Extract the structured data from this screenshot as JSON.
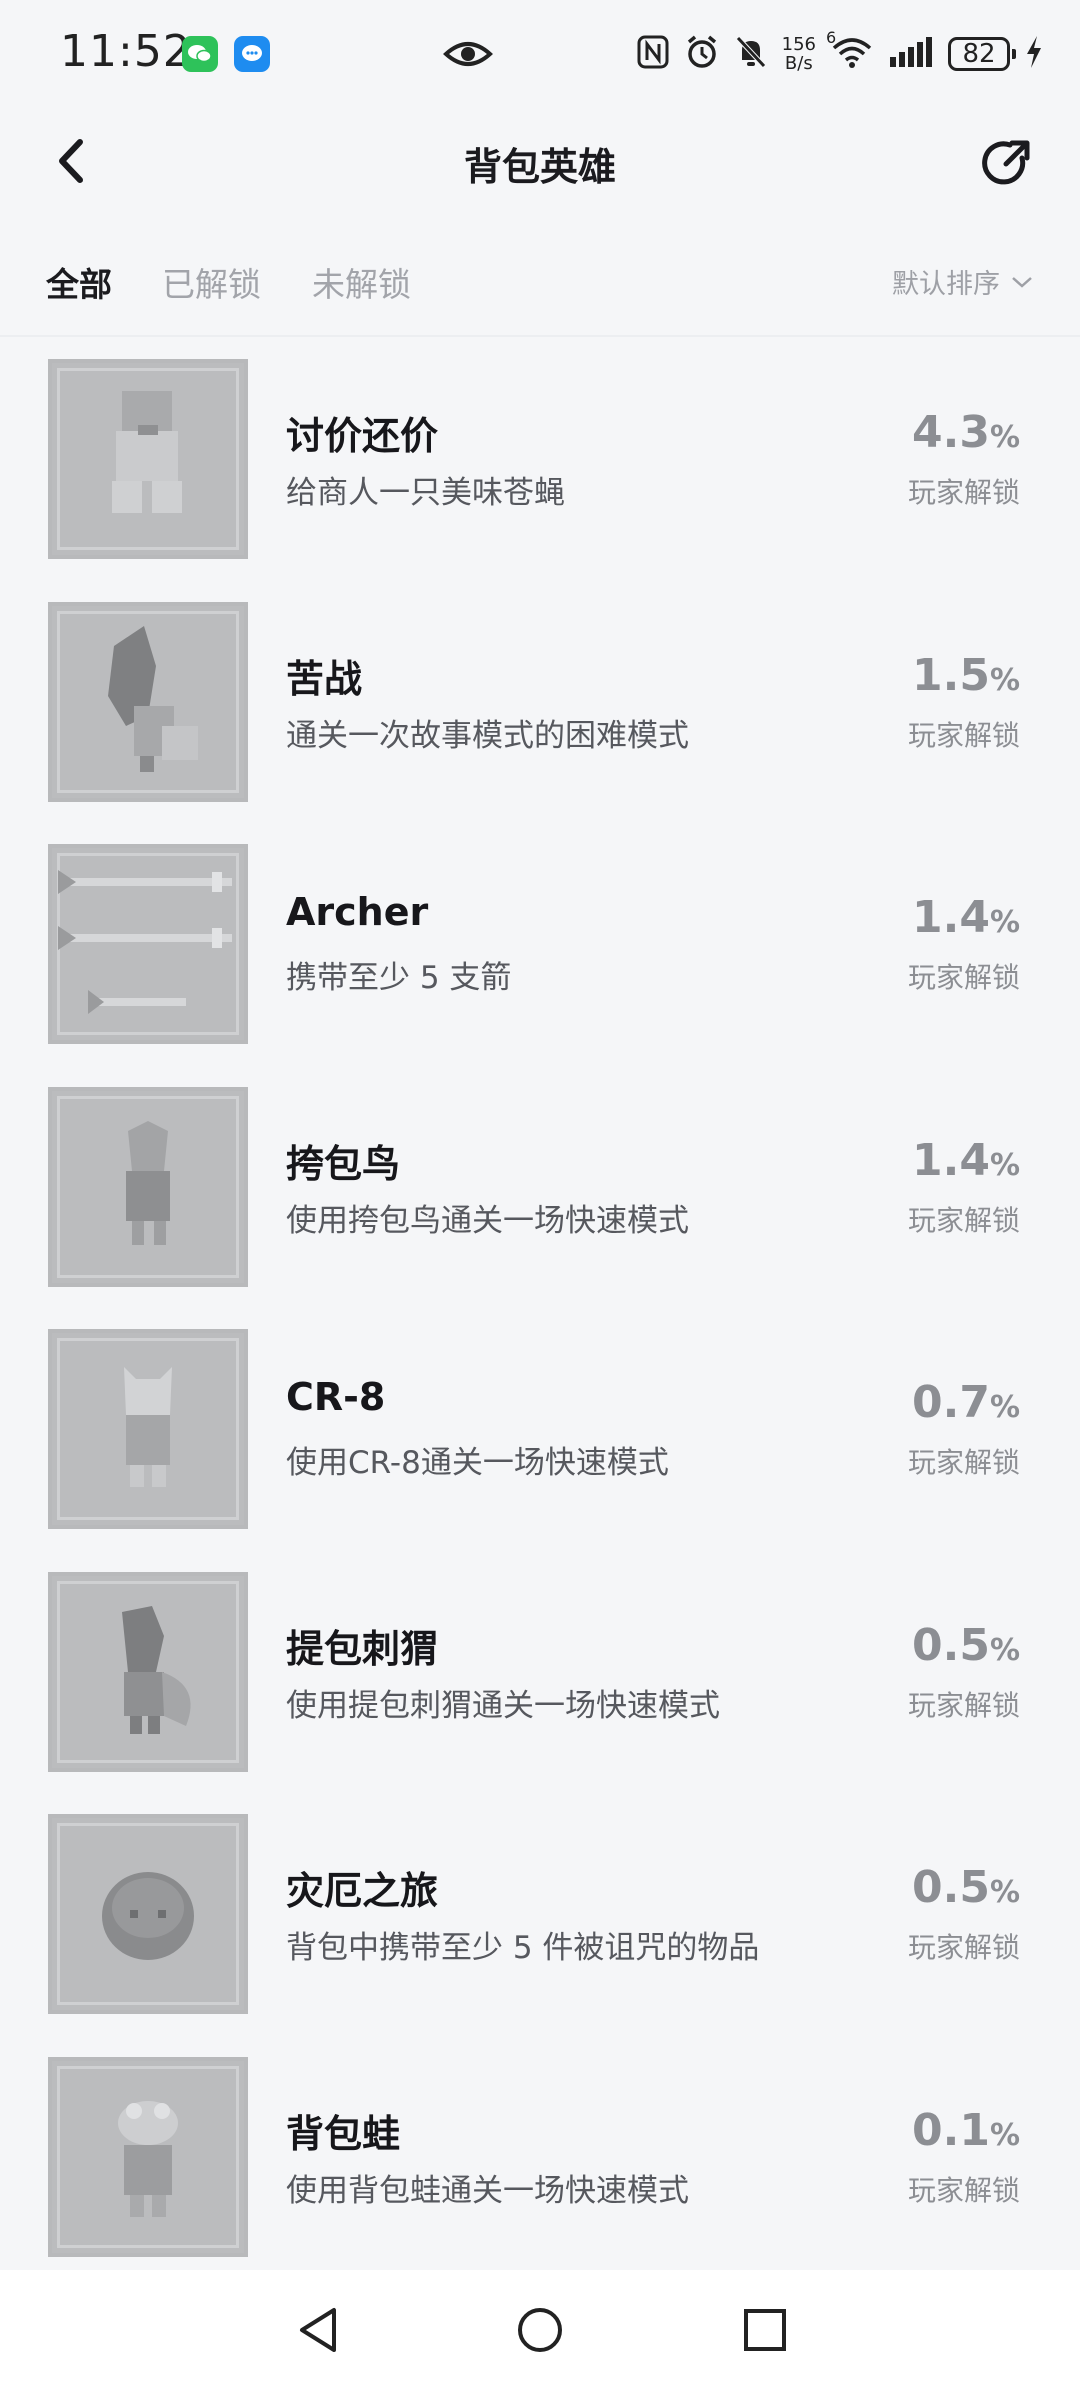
{
  "status_bar": {
    "time": "11:52",
    "net_speed_value": "156",
    "net_speed_unit": "B/s",
    "wifi_badge": "6",
    "battery": "82",
    "icons": [
      "wechat-icon",
      "message-icon",
      "eye-icon",
      "nfc-icon",
      "alarm-icon",
      "mute-icon",
      "wifi-icon",
      "signal-icon",
      "battery-icon",
      "charging-icon"
    ]
  },
  "header": {
    "title": "背包英雄",
    "back_icon": "chevron-left-icon",
    "share_icon": "share-icon"
  },
  "tabs": {
    "all": "全部",
    "unlocked": "已解锁",
    "locked": "未解锁",
    "active": "all",
    "sort_label": "默认排序"
  },
  "achievements": [
    {
      "title": "讨价还价",
      "desc": "给商人一只美味苍蝇",
      "percent": "4.3",
      "unit": "%",
      "label": "玩家解锁"
    },
    {
      "title": "苦战",
      "desc": "通关一次故事模式的困难模式",
      "percent": "1.5",
      "unit": "%",
      "label": "玩家解锁"
    },
    {
      "title": "Archer",
      "desc": "携带至少 5 支箭",
      "percent": "1.4",
      "unit": "%",
      "label": "玩家解锁"
    },
    {
      "title": "挎包鸟",
      "desc": "使用挎包鸟通关一场快速模式",
      "percent": "1.4",
      "unit": "%",
      "label": "玩家解锁"
    },
    {
      "title": "CR-8",
      "desc": "使用CR-8通关一场快速模式",
      "percent": "0.7",
      "unit": "%",
      "label": "玩家解锁"
    },
    {
      "title": "提包刺猬",
      "desc": "使用提包刺猬通关一场快速模式",
      "percent": "0.5",
      "unit": "%",
      "label": "玩家解锁"
    },
    {
      "title": "灾厄之旅",
      "desc": "背包中携带至少 5 件被诅咒的物品",
      "percent": "0.5",
      "unit": "%",
      "label": "玩家解锁"
    },
    {
      "title": "背包蛙",
      "desc": "使用背包蛙通关一场快速模式",
      "percent": "0.1",
      "unit": "%",
      "label": "玩家解锁"
    }
  ],
  "colors": {
    "background": "#f5f6f8",
    "text_primary": "#1b1b1f",
    "text_muted": "#8c8e93",
    "thumb_locked": "#bbbcbe"
  }
}
